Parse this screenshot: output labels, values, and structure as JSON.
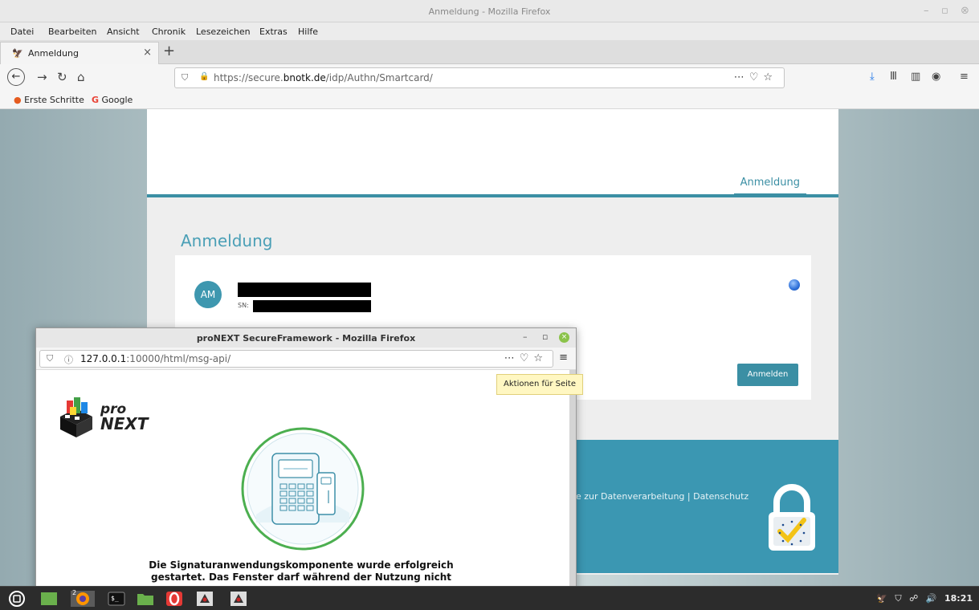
{
  "window": {
    "title": "Anmeldung - Mozilla Firefox"
  },
  "menu": [
    "Datei",
    "Bearbeiten",
    "Ansicht",
    "Chronik",
    "Lesezeichen",
    "Extras",
    "Hilfe"
  ],
  "tab": {
    "label": "Anmeldung"
  },
  "address": {
    "prefix": "https://secure.",
    "domain": "bnotk.de",
    "path": "/idp/Authn/Smartcard/"
  },
  "bookmarks": [
    "Erste Schritte",
    "Google"
  ],
  "page": {
    "nav_label": "Anmeldung",
    "heading": "Anmeldung",
    "card": {
      "avatar_initials": "AM",
      "sn_label": "SN:",
      "button_label": "Anmelden"
    },
    "footer_links": "e zur Datenverarbeitung   |  Datenschutz"
  },
  "popup": {
    "title": "proNEXT SecureFramework - Mozilla Firefox",
    "url_host": "127.0.0.1",
    "url_rest": ":10000/html/msg-api/",
    "logo_pro": "pro",
    "logo_next": "NEXT",
    "message": "Die Signaturanwendungskomponente wurde erfolgreich gestartet. Das Fenster darf während der Nutzung nicht"
  },
  "tooltip": "Aktionen für Seite",
  "taskbar": {
    "clock": "18:21",
    "firefox_badge": "2"
  },
  "colors": {
    "accent": "#3b8fa4",
    "footer": "#3b97b2",
    "heading": "#4a9fb6"
  }
}
